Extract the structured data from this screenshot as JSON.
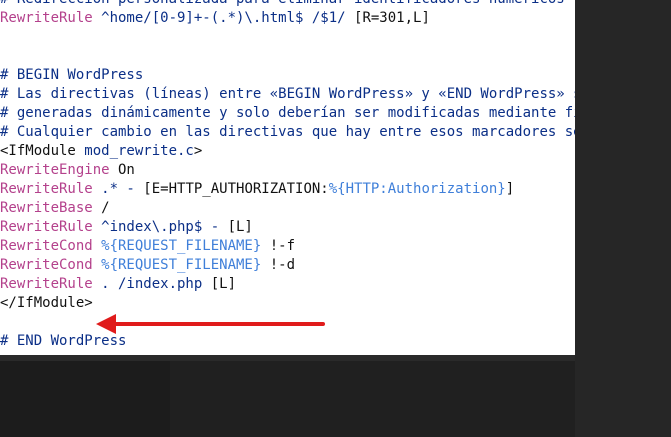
{
  "lines": [
    [
      {
        "c": "t-comment",
        "t": "# Redirección personalizada para eliminar identificadores numéricos"
      }
    ],
    [
      {
        "c": "t-directive",
        "t": "RewriteRule"
      },
      {
        "c": "t-arg",
        "t": " ^home/[0-9]+-(.*)\\.html$ /$1/"
      },
      {
        "c": "t-plain",
        "t": " [R=301,L]"
      }
    ],
    [],
    [],
    [
      {
        "c": "t-comment",
        "t": "# BEGIN WordPress"
      }
    ],
    [
      {
        "c": "t-comment",
        "t": "# Las directivas (líneas) entre «BEGIN WordPress» y «END WordPress» son"
      }
    ],
    [
      {
        "c": "t-comment",
        "t": "# generadas dinámicamente y solo deberían ser modificadas mediante filtros"
      }
    ],
    [
      {
        "c": "t-comment",
        "t": "# Cualquier cambio en las directivas que hay entre esos marcadores será sobrescrito."
      }
    ],
    [
      {
        "c": "t-tag",
        "t": "<IfModule"
      },
      {
        "c": "t-arg",
        "t": " mod_rewrite.c"
      },
      {
        "c": "t-tag",
        "t": ">"
      }
    ],
    [
      {
        "c": "t-directive",
        "t": "RewriteEngine"
      },
      {
        "c": "t-plain",
        "t": " On"
      }
    ],
    [
      {
        "c": "t-directive",
        "t": "RewriteRule"
      },
      {
        "c": "t-arg",
        "t": " .* - "
      },
      {
        "c": "t-plain",
        "t": "[E=HTTP_AUTHORIZATION:"
      },
      {
        "c": "t-var",
        "t": "%{HTTP:Authorization}"
      },
      {
        "c": "t-plain",
        "t": "]"
      }
    ],
    [
      {
        "c": "t-directive",
        "t": "RewriteBase"
      },
      {
        "c": "t-plain",
        "t": " /"
      }
    ],
    [
      {
        "c": "t-directive",
        "t": "RewriteRule"
      },
      {
        "c": "t-arg",
        "t": " ^index\\.php$ - "
      },
      {
        "c": "t-plain",
        "t": "[L]"
      }
    ],
    [
      {
        "c": "t-directive",
        "t": "RewriteCond"
      },
      {
        "c": "t-var",
        "t": " %{REQUEST_FILENAME}"
      },
      {
        "c": "t-plain",
        "t": " !-f"
      }
    ],
    [
      {
        "c": "t-directive",
        "t": "RewriteCond"
      },
      {
        "c": "t-var",
        "t": " %{REQUEST_FILENAME}"
      },
      {
        "c": "t-plain",
        "t": " !-d"
      }
    ],
    [
      {
        "c": "t-directive",
        "t": "RewriteRule"
      },
      {
        "c": "t-arg",
        "t": " . /index.php"
      },
      {
        "c": "t-plain",
        "t": " [L]"
      }
    ],
    [
      {
        "c": "t-tag",
        "t": "</IfModule>"
      }
    ],
    [],
    [
      {
        "c": "t-comment",
        "t": "# END WordPress"
      }
    ]
  ],
  "colors": {
    "comment": "#0b2f87",
    "directive": "#b4418c",
    "variable": "#3f7fd9",
    "arrow": "#e01b1b"
  },
  "annotation": {
    "icon": "red-arrow-left-icon"
  }
}
